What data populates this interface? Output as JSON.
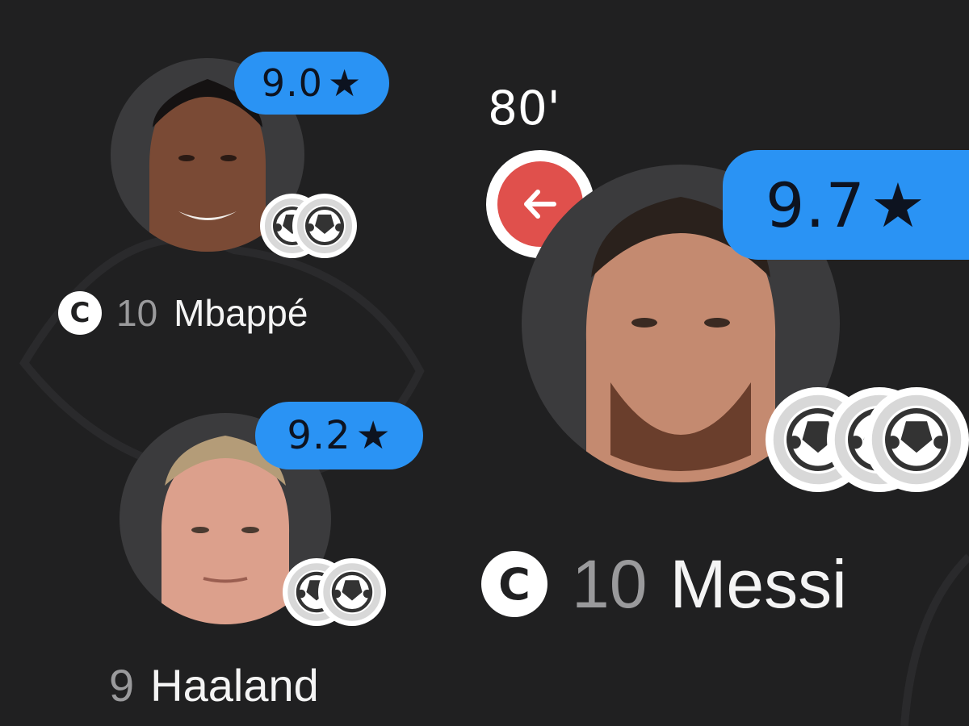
{
  "players": [
    {
      "id": "mbappe",
      "rating": "9.0",
      "captain_mark": "C",
      "number": "10",
      "name": "Mbappé",
      "goals": 2,
      "captain": true
    },
    {
      "id": "haaland",
      "rating": "9.2",
      "captain_mark": "",
      "number": "9",
      "name": "Haaland",
      "goals": 2,
      "captain": false
    },
    {
      "id": "messi",
      "rating": "9.7",
      "captain_mark": "C",
      "number": "10",
      "name": "Messi",
      "goals": 3,
      "captain": true,
      "sub_time": "80'",
      "sub_icon": "substitution-out-arrow-icon"
    }
  ],
  "icons": {
    "rating": "star-icon",
    "goal": "football-icon",
    "captain": "captain-icon"
  },
  "colors": {
    "background": "#202021",
    "rating_badge": "#2a93f4",
    "sub_out": "#e0504c",
    "number_text": "#9a9a9c",
    "name_text": "#f4f4f4"
  }
}
